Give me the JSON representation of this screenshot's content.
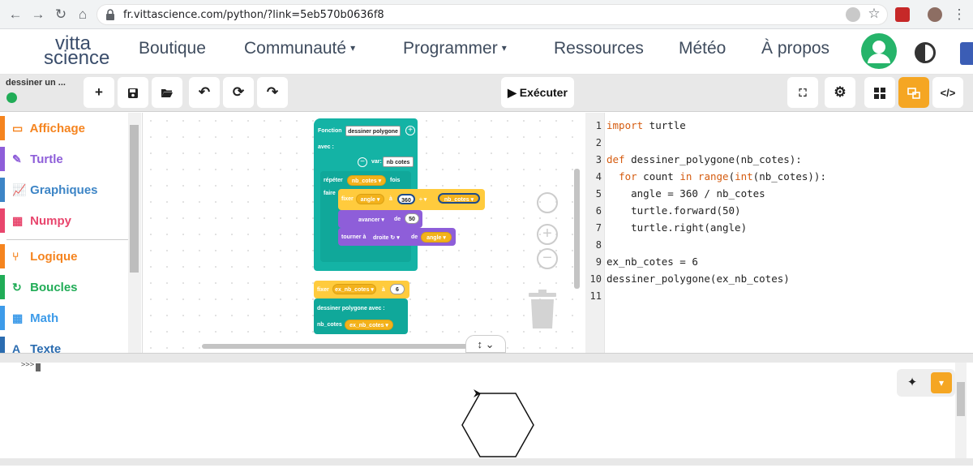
{
  "browser": {
    "url": "fr.vittascience.com/python/?link=5eb570b0636f8",
    "buttons": [
      "back-icon",
      "forward-icon",
      "reload-icon",
      "home-icon"
    ]
  },
  "site": {
    "logo_line1": "vitta",
    "logo_line2": "science",
    "nav": [
      {
        "label": "Boutique"
      },
      {
        "label": "Communauté",
        "caret": "▾"
      },
      {
        "label": "Programmer",
        "caret": "▾"
      },
      {
        "label": "Ressources"
      },
      {
        "label": "Météo"
      },
      {
        "label": "À propos"
      }
    ]
  },
  "toolbar": {
    "project_name": "dessiner un ...",
    "run_label": "Exécuter",
    "run_glyph": "▶"
  },
  "categories": [
    {
      "label": "Affichage",
      "color": "#f5841f",
      "icon": "▭"
    },
    {
      "label": "Turtle",
      "color": "#8e5ed9",
      "icon": "✎"
    },
    {
      "label": "Graphiques",
      "color": "#3d85c6",
      "icon": "📈"
    },
    {
      "label": "Numpy",
      "color": "#e8466d",
      "icon": "▦"
    },
    {
      "label": "Logique",
      "color": "#f5841f",
      "icon": "⑂"
    },
    {
      "label": "Boucles",
      "color": "#21ac57",
      "icon": "↻"
    },
    {
      "label": "Math",
      "color": "#3d9be9",
      "icon": "▦"
    },
    {
      "label": "Texte",
      "color": "#2b6cb0",
      "icon": "A"
    }
  ],
  "blocks": {
    "fn_label": "Fonction",
    "fn_name": "dessiner polygone",
    "avec": "avec :",
    "var_label": "var:",
    "var_name": "nb cotes",
    "repeter": "répéter",
    "repeat_var": "nb_cotes ▾",
    "fois": "fois",
    "faire": "faire",
    "fixer": "fixer",
    "angle_var": "angle ▾",
    "a": "à",
    "num360": "360",
    "div": "÷ ▾",
    "div_var": "nb_cotes ▾",
    "avancer": "avancer ▾",
    "de": "de",
    "num50": "50",
    "tourner": "tourner à",
    "droite": "droite ↻ ▾",
    "de2": "de",
    "angle_var2": "angle ▾",
    "fixer2": "fixer",
    "ex_var": "ex_nb_cotes ▾",
    "a2": "à",
    "num6": "6",
    "call": "dessiner polygone  avec :",
    "nb_cotes_lbl": "nb_cotes",
    "ex_var2": "ex_nb_cotes ▾"
  },
  "code": {
    "lines": [
      {
        "n": "1",
        "parts": [
          {
            "t": "import",
            "k": true
          },
          {
            "t": " turtle"
          }
        ]
      },
      {
        "n": "2",
        "parts": []
      },
      {
        "n": "3",
        "parts": [
          {
            "t": "def",
            "k": true
          },
          {
            "t": " dessiner_polygone(nb_cotes):"
          }
        ]
      },
      {
        "n": "4",
        "parts": [
          {
            "t": "  "
          },
          {
            "t": "for",
            "k": true
          },
          {
            "t": " count "
          },
          {
            "t": "in",
            "k": true
          },
          {
            "t": " "
          },
          {
            "t": "range",
            "k": true
          },
          {
            "t": "("
          },
          {
            "t": "int",
            "k": true
          },
          {
            "t": "(nb_cotes)):"
          }
        ]
      },
      {
        "n": "5",
        "parts": [
          {
            "t": "    angle = 360 / nb_cotes"
          }
        ]
      },
      {
        "n": "6",
        "parts": [
          {
            "t": "    turtle.forward(50)"
          }
        ]
      },
      {
        "n": "7",
        "parts": [
          {
            "t": "    turtle.right(angle)"
          }
        ]
      },
      {
        "n": "8",
        "parts": []
      },
      {
        "n": "9",
        "parts": [
          {
            "t": "ex_nb_cotes = 6"
          }
        ]
      },
      {
        "n": "10",
        "parts": [
          {
            "t": "dessiner_polygone(ex_nb_cotes)"
          }
        ]
      },
      {
        "n": "11",
        "parts": []
      }
    ]
  },
  "console": {
    "prompt": ">>>"
  },
  "colors": {
    "accent": "#f5a623",
    "teal": "#14b3a5",
    "yellow": "#ffcb3d",
    "purple": "#8e5ed9",
    "keyword": "#d55c10"
  }
}
